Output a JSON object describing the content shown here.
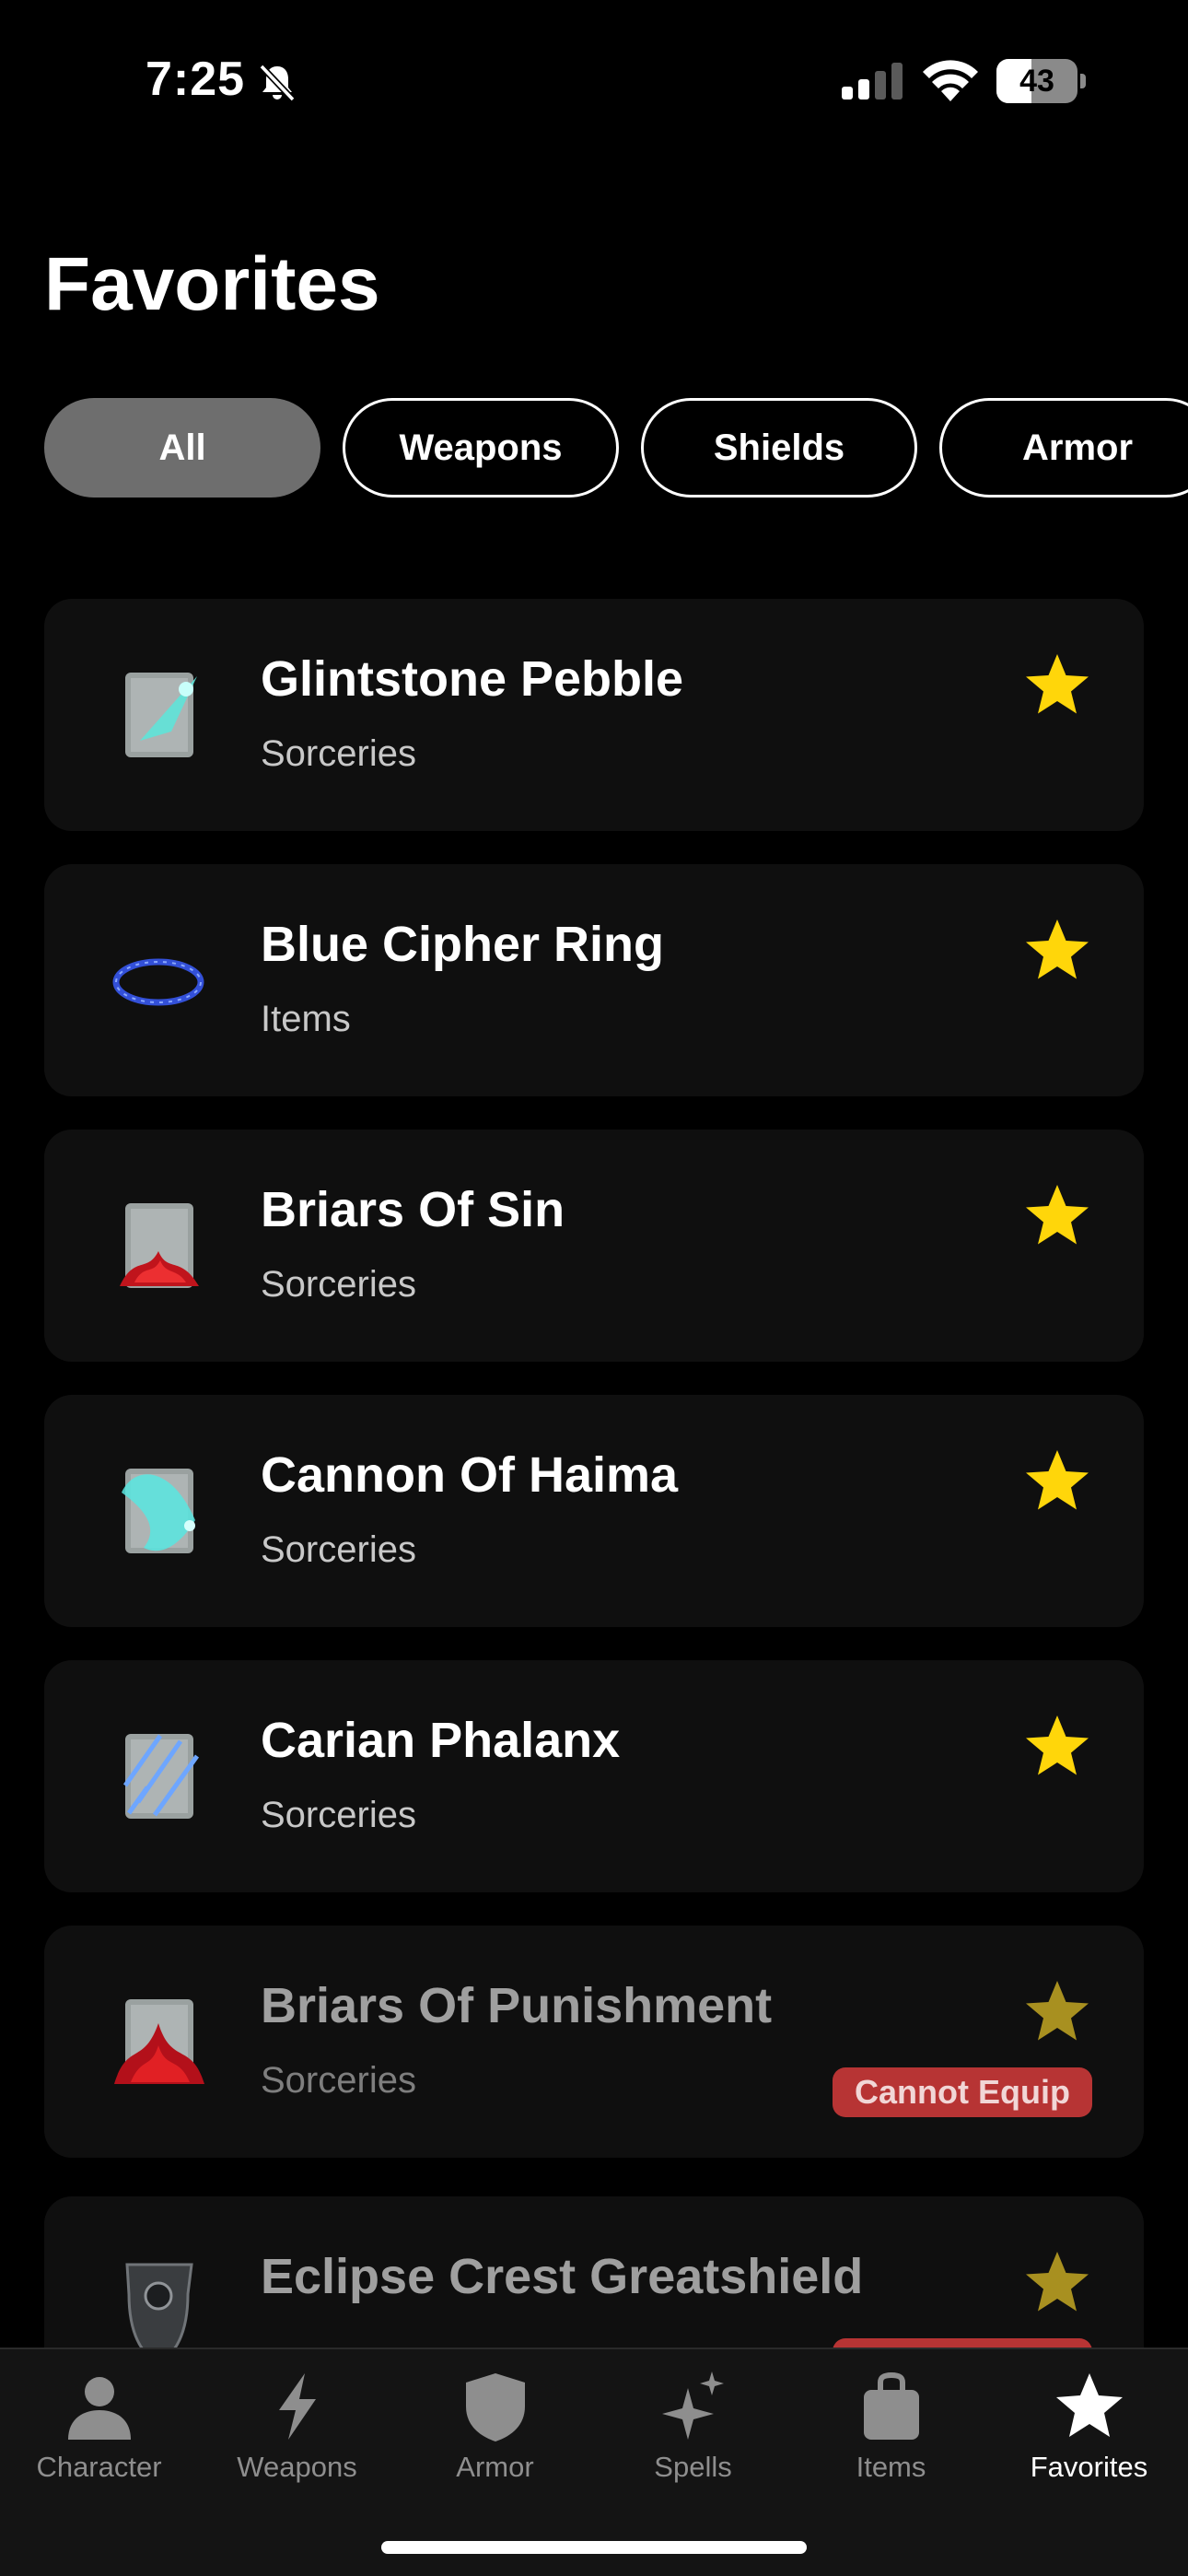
{
  "status_bar": {
    "time": "7:25",
    "battery": "43",
    "battery_level": 0.43
  },
  "page": {
    "title": "Favorites"
  },
  "filters": [
    {
      "label": "All",
      "active": true
    },
    {
      "label": "Weapons",
      "active": false
    },
    {
      "label": "Shields",
      "active": false
    },
    {
      "label": "Armor",
      "active": false
    }
  ],
  "favorites": [
    {
      "title": "Glintstone Pebble",
      "category": "Sorceries",
      "icon": "glintstone-pebble-icon",
      "starred": true,
      "equippable": true
    },
    {
      "title": "Blue Cipher Ring",
      "category": "Items",
      "icon": "blue-cipher-ring-icon",
      "starred": true,
      "equippable": true
    },
    {
      "title": "Briars Of Sin",
      "category": "Sorceries",
      "icon": "briars-of-sin-icon",
      "starred": true,
      "equippable": true
    },
    {
      "title": "Cannon Of Haima",
      "category": "Sorceries",
      "icon": "cannon-of-haima-icon",
      "starred": true,
      "equippable": true
    },
    {
      "title": "Carian Phalanx",
      "category": "Sorceries",
      "icon": "carian-phalanx-icon",
      "starred": true,
      "equippable": true
    },
    {
      "title": "Briars Of Punishment",
      "category": "Sorceries",
      "icon": "briars-of-punishment-icon",
      "starred": true,
      "equippable": false,
      "badge": "Cannot Equip"
    },
    {
      "title": "Eclipse Crest Greatshield",
      "category": "",
      "icon": "eclipse-crest-greatshield-icon",
      "starred": true,
      "equippable": false,
      "badge": "Cannot Equip"
    }
  ],
  "tab_bar": {
    "tabs": [
      {
        "label": "Character",
        "icon": "person-icon",
        "active": false
      },
      {
        "label": "Weapons",
        "icon": "lightning-icon",
        "active": false
      },
      {
        "label": "Armor",
        "icon": "shield-icon",
        "active": false
      },
      {
        "label": "Spells",
        "icon": "sparkles-icon",
        "active": false
      },
      {
        "label": "Items",
        "icon": "bag-icon",
        "active": false
      },
      {
        "label": "Favorites",
        "icon": "star-icon",
        "active": true
      }
    ]
  },
  "colors": {
    "star": "#ffd60a",
    "star_dim": "#a89020",
    "badge": "#b73434",
    "card": "#0f0f0f",
    "chip_active": "#6e6e6e"
  }
}
